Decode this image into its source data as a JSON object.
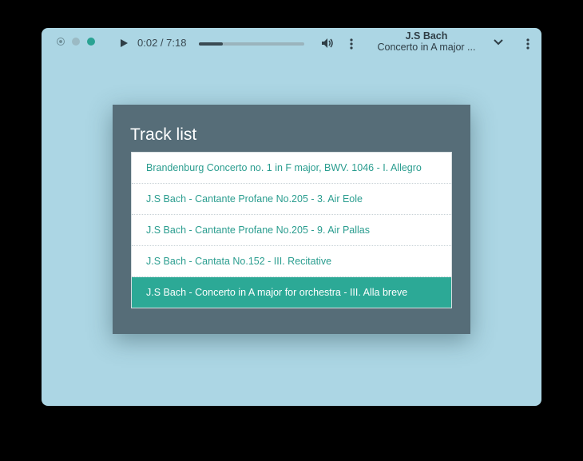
{
  "player": {
    "time_display": "0:02 / 7:18",
    "progress": 0.23,
    "now_playing": {
      "artist": "J.S Bach",
      "title": "Concerto in A major ..."
    }
  },
  "colors": {
    "window_bg": "#acd6e4",
    "panel_bg": "#566d78",
    "accent": "#2ca996"
  },
  "track_list": {
    "title": "Track list",
    "tracks": [
      {
        "label": "Brandenburg Concerto no. 1 in F major, BWV. 1046 - I. Allegro",
        "active": false
      },
      {
        "label": "J.S Bach - Cantante Profane No.205 - 3. Air Eole",
        "active": false
      },
      {
        "label": "J.S Bach - Cantante Profane No.205 - 9. Air Pallas",
        "active": false
      },
      {
        "label": "J.S Bach - Cantata No.152 - III. Recitative",
        "active": false
      },
      {
        "label": "J.S Bach - Concerto in A major for orchestra - III. Alla breve",
        "active": true
      }
    ]
  }
}
